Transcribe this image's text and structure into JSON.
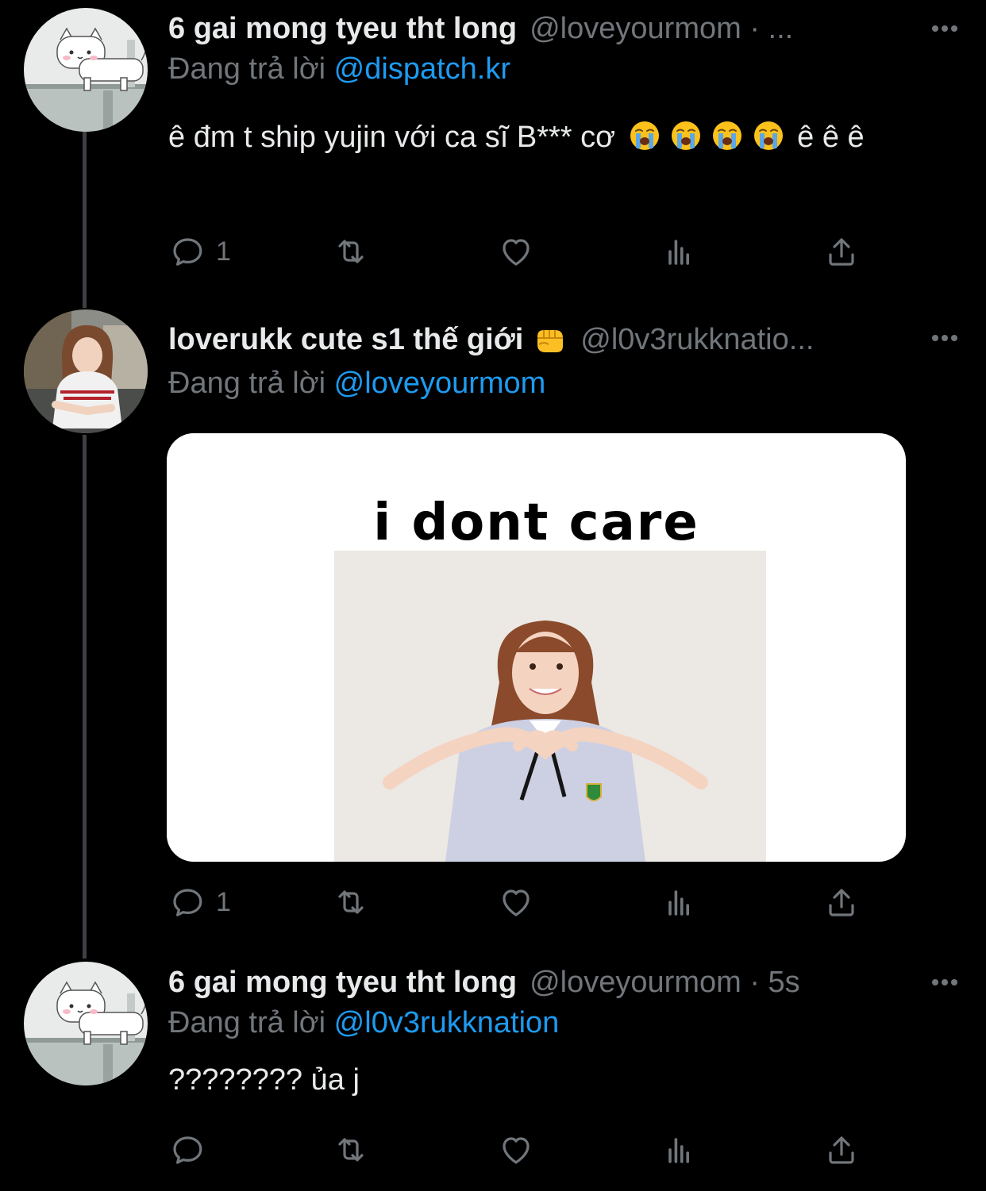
{
  "colors": {
    "background": "#000000",
    "primary_text": "#e7e9ea",
    "secondary_text": "#71767b",
    "accent": "#1d9bf0",
    "thread_line": "#3e4144"
  },
  "tweets": [
    {
      "display_name": "6 gai mong tyeu tht long",
      "handle": "@loveyourmom · ...",
      "reply_prefix": "Đang trả lời",
      "reply_to": "@dispatch.kr",
      "text_before_emoji": "ê đm t ship yujin với ca sĩ B*** cơ",
      "emoji": [
        "loudly-crying-face",
        "loudly-crying-face",
        "loudly-crying-face",
        "loudly-crying-face"
      ],
      "text_after_emoji": "ê ê ê",
      "reply_count": "1",
      "avatar": "white-cat-avatar"
    },
    {
      "display_name": "loverukk cute s1 thế giới",
      "badge_emoji": "oncoming-fist",
      "handle": "@l0v3rukknatio...",
      "reply_prefix": "Đang trả lời",
      "reply_to": "@loveyourmom",
      "media": {
        "caption": "i dont care",
        "image": "girl-making-heart-hands-photo"
      },
      "reply_count": "1",
      "avatar": "girl-portrait-avatar"
    },
    {
      "display_name": "6 gai mong tyeu tht long",
      "handle": "@loveyourmom · 5s",
      "reply_prefix": "Đang trả lời",
      "reply_to": "@l0v3rukknation",
      "text": "???????? ủa j",
      "reply_count": "",
      "avatar": "white-cat-avatar"
    }
  ],
  "action_icons": [
    "reply-icon",
    "retweet-icon",
    "like-icon",
    "views-icon",
    "share-icon"
  ],
  "more_icon": "more-options-icon"
}
